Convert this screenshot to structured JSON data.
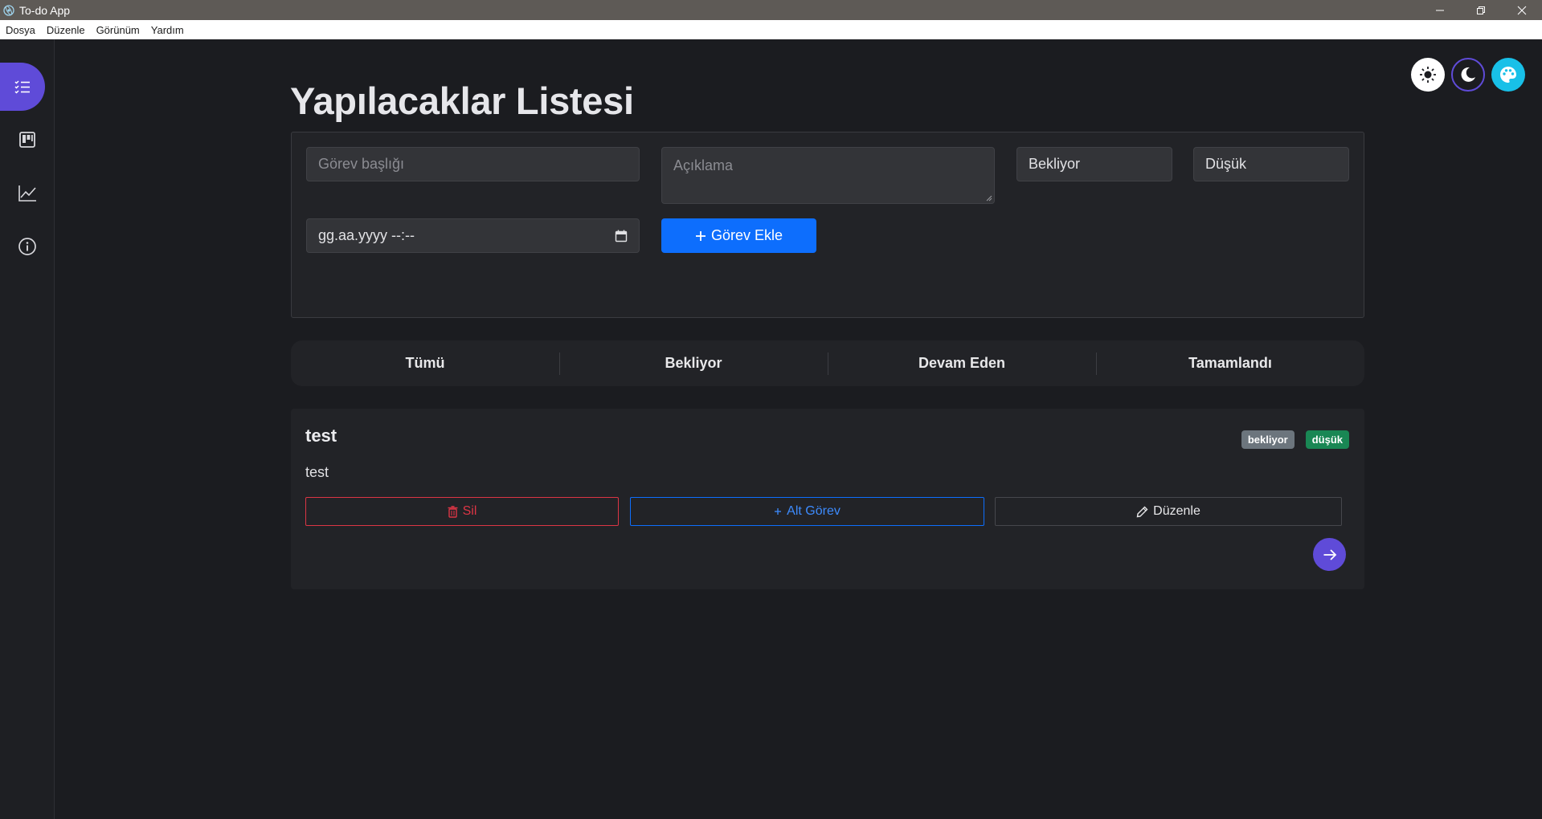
{
  "window": {
    "title": "To-do App",
    "controls": [
      "minimize-icon",
      "restore-icon",
      "close-icon"
    ]
  },
  "menu": {
    "items": [
      "Dosya",
      "Düzenle",
      "Görünüm",
      "Yardım"
    ]
  },
  "sidebar": {
    "items": [
      {
        "icon": "list-icon",
        "active": true
      },
      {
        "icon": "kanban-icon",
        "active": false
      },
      {
        "icon": "chart-line-icon",
        "active": false
      },
      {
        "icon": "info-icon",
        "active": false
      }
    ]
  },
  "theme": {
    "buttons": [
      "sun-icon",
      "moon-icon",
      "palette-icon"
    ],
    "colors": {
      "accent": "#5f4bd8",
      "color_theme": "#18c0e8"
    }
  },
  "page": {
    "title": "Yapılacaklar Listesi"
  },
  "form": {
    "title_placeholder": "Görev başlığı",
    "description_placeholder": "Açıklama",
    "status_value": "Bekliyor",
    "priority_value": "Düşük",
    "date_placeholder": "gg.aa.yyyy --:--",
    "add_button": "Görev Ekle"
  },
  "filters": {
    "tabs": [
      "Tümü",
      "Bekliyor",
      "Devam Eden",
      "Tamamlandı"
    ]
  },
  "task": {
    "title": "test",
    "description": "test",
    "status_badge": "bekliyor",
    "priority_badge": "düşük",
    "delete_button": "Sil",
    "subtask_button": "Alt Görev",
    "edit_button": "Düzenle"
  },
  "colors": {
    "primary": "#0d6efd",
    "danger": "#dc3545",
    "success": "#198754",
    "secondary": "#6c757d"
  }
}
